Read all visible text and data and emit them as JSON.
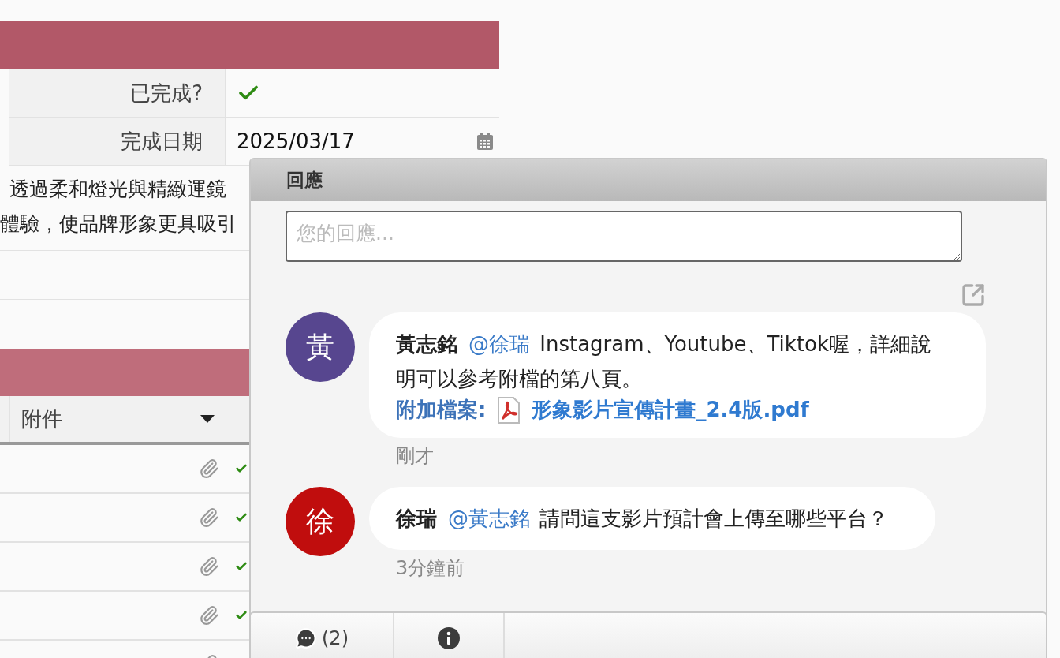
{
  "form_fields": [
    {
      "label": "已完成?",
      "kind": "check",
      "checked": true
    },
    {
      "label": "完成日期",
      "kind": "date",
      "value": "2025/03/17"
    }
  ],
  "description_lines": [
    "透過柔和燈光與精緻運鏡",
    "體驗，使品牌形象更具吸引"
  ],
  "table": {
    "columns": [
      "附件"
    ],
    "rows": [
      {
        "attachment": true,
        "done": true
      },
      {
        "attachment": true,
        "done": true
      },
      {
        "attachment": true,
        "done": true
      },
      {
        "attachment": true,
        "done": true
      },
      {
        "attachment": true
      }
    ]
  },
  "comments_panel": {
    "title": "回應",
    "placeholder": "您的回應...",
    "comments": [
      {
        "avatar": "黃",
        "color": "#57468f",
        "author": "黃志銘",
        "mention": "@徐瑞",
        "text": "Instagram、Youtube、Tiktok喔，詳細說明可以參考附檔的第八頁。",
        "attachment_label": "附加檔案:",
        "attachment": "形象影片宣傳計畫_2.4版.pdf",
        "time": "剛才"
      },
      {
        "avatar": "徐",
        "color": "#c00d0d",
        "author": "徐瑞",
        "mention": "@黃志銘",
        "text": "請問這支影片預計會上傳至哪些平台？",
        "time": "3分鐘前"
      }
    ],
    "tabs": [
      {
        "kind": "comments",
        "label": "(2)"
      },
      {
        "kind": "info"
      }
    ]
  }
}
